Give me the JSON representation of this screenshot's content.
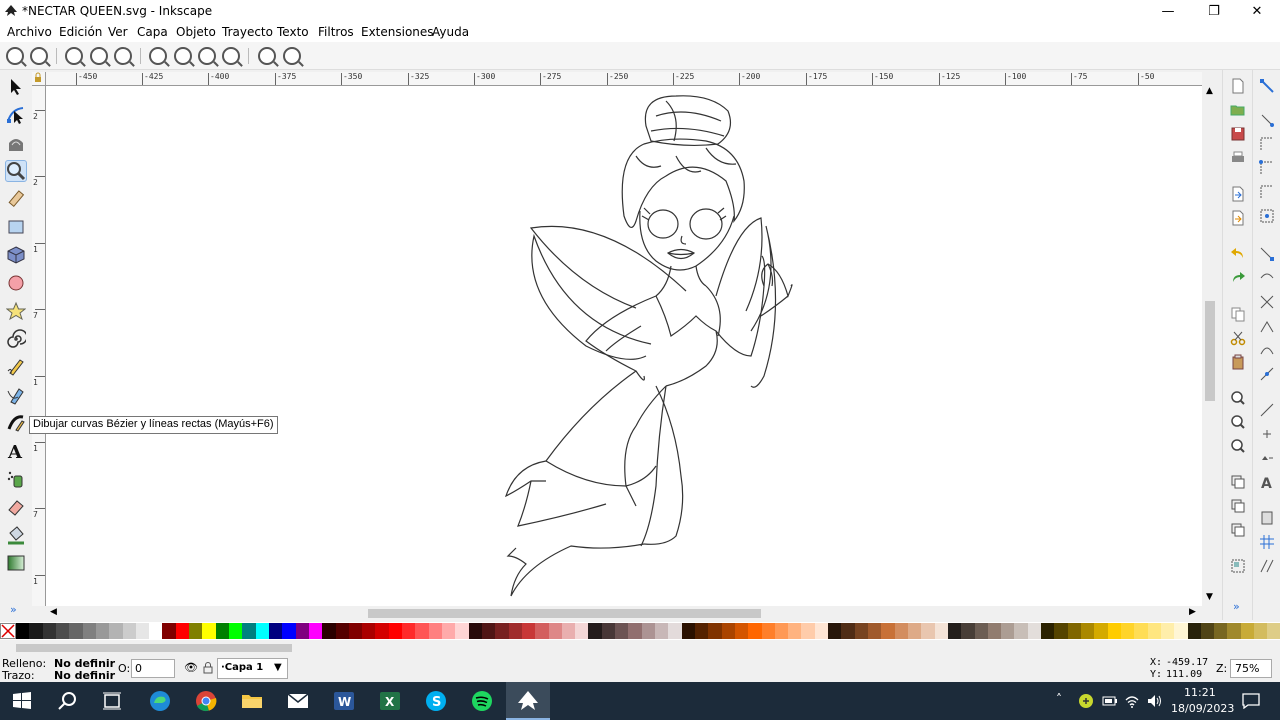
{
  "window": {
    "title": "*NECTAR QUEEN.svg - Inkscape",
    "minimize": "—",
    "maximize": "❐",
    "close": "✕"
  },
  "menu": [
    {
      "label": "Archivo",
      "key": "A"
    },
    {
      "label": "Edición",
      "key": "E"
    },
    {
      "label": "Ver",
      "key": "V"
    },
    {
      "label": "Capa",
      "key": "C"
    },
    {
      "label": "Objeto",
      "key": "O"
    },
    {
      "label": "Trayecto",
      "key": "T"
    },
    {
      "label": "Texto",
      "key": "x"
    },
    {
      "label": "Filtros",
      "key": "F"
    },
    {
      "label": "Extensiones",
      "key": "n"
    },
    {
      "label": "Ayuda",
      "key": "y"
    }
  ],
  "tooltip": "Dibujar curvas Bézier y líneas rectas (Mayús+F6)",
  "ruler": {
    "h_labels": [
      "-450",
      "-425",
      "-400",
      "-375",
      "-350",
      "-325",
      "-300",
      "-275",
      "-250",
      "-225",
      "-200",
      "-175",
      "-150",
      "-125",
      "-100",
      "-75",
      "-50"
    ],
    "v_labels": [
      "2",
      "2",
      "1",
      "7",
      "1",
      "1",
      "7",
      "1",
      "0",
      "7",
      "5",
      "2"
    ]
  },
  "status": {
    "fill_label": "Relleno:",
    "fill_value": "No definir",
    "stroke_label": "Trazo:",
    "stroke_value": "No definir",
    "opacity_label": "O:",
    "opacity_value": "0",
    "layer": "·Capa 1",
    "x_label": "X:",
    "x_value": "-459.17",
    "y_label": "Y:",
    "y_value": "111.09",
    "zoom_label": "Z:",
    "zoom_value": "75%"
  },
  "taskbar": {
    "time": "11:21",
    "date": "18/09/2023"
  },
  "palette_colors": [
    "#000000",
    "#1a1a1a",
    "#333333",
    "#4d4d4d",
    "#666666",
    "#808080",
    "#999999",
    "#b3b3b3",
    "#cccccc",
    "#e6e6e6",
    "#ffffff",
    "#800000",
    "#ff0000",
    "#808000",
    "#ffff00",
    "#008000",
    "#00ff00",
    "#008080",
    "#00ffff",
    "#000080",
    "#0000ff",
    "#800080",
    "#ff00ff",
    "#2b0000",
    "#550000",
    "#800000",
    "#aa0000",
    "#d40000",
    "#ff0000",
    "#ff2a2a",
    "#ff5555",
    "#ff8080",
    "#ffaaaa",
    "#ffd5d5",
    "#280b0b",
    "#501616",
    "#782121",
    "#a02c2c",
    "#c83737",
    "#d35f5f",
    "#de8787",
    "#e9afaf",
    "#f4d7d7",
    "#241c1c",
    "#483737",
    "#6c5353",
    "#916f6f",
    "#ac9393",
    "#c8b7b7",
    "#e3dbdb",
    "#2b1100",
    "#552200",
    "#803300",
    "#aa4400",
    "#d45500",
    "#ff6600",
    "#ff7f2a",
    "#ff9955",
    "#ffb380",
    "#ffccaa",
    "#ffe6d5",
    "#28170b",
    "#502d16",
    "#784421",
    "#a05a2c",
    "#c87137",
    "#d38d5f",
    "#deaa87",
    "#e9c6af",
    "#f4e3d7",
    "#241f1c",
    "#483e37",
    "#6c5d53",
    "#917c6f",
    "#ac9d93",
    "#c8beb7",
    "#e3dedb",
    "#2b2200",
    "#554400",
    "#806600",
    "#aa8800",
    "#d4aa00",
    "#ffcc00",
    "#ffd42a",
    "#ffdd55",
    "#ffe680",
    "#ffeeaa",
    "#fff6d5",
    "#28220b",
    "#504416",
    "#786721",
    "#a0892c",
    "#c8ab37",
    "#d3bc5f",
    "#decd87"
  ]
}
